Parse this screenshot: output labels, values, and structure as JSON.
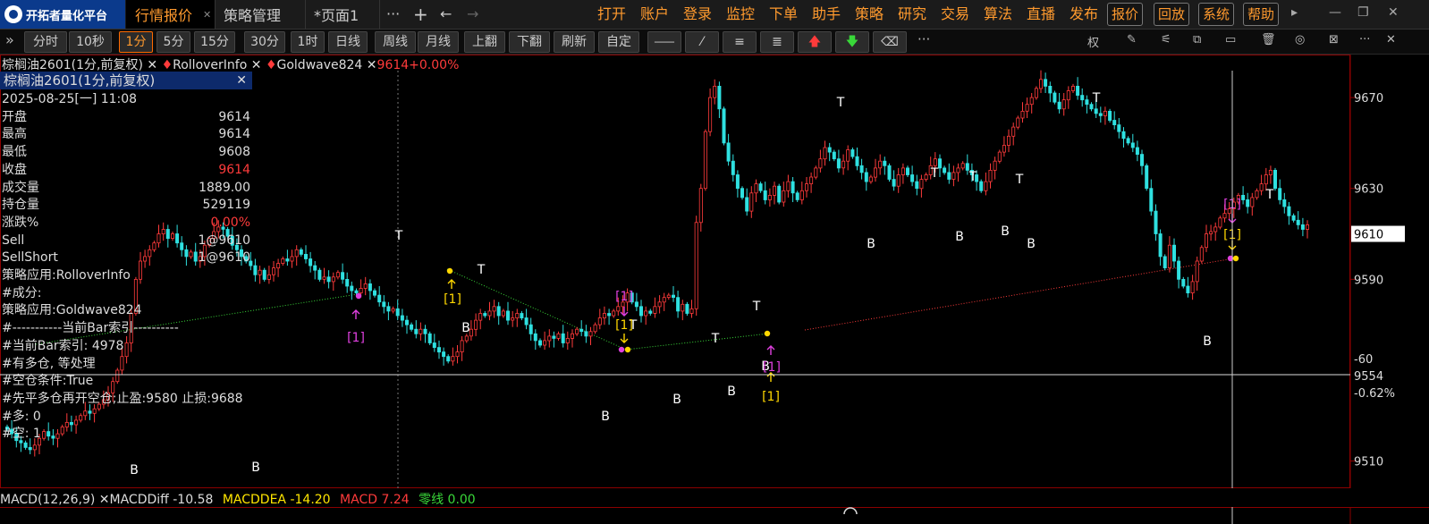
{
  "app": {
    "logo_text": "开拓者量化平台"
  },
  "tabs": [
    {
      "label": "行情报价",
      "active": true,
      "closable": true
    },
    {
      "label": "策略管理",
      "active": false,
      "closable": false
    },
    {
      "label": "*页面1",
      "active": false,
      "closable": false
    }
  ],
  "tab_actions": {
    "more": "···",
    "add": "+",
    "back": "←",
    "forward": "→"
  },
  "menu": [
    "打开",
    "账户",
    "登录",
    "监控",
    "下单",
    "助手",
    "策略",
    "研究",
    "交易",
    "算法",
    "直播",
    "发布"
  ],
  "menu_buttons": [
    "报价",
    "回放",
    "系统",
    "帮助"
  ],
  "window_controls": {
    "arrow": "▸",
    "min": "—",
    "max": "❐",
    "close": "✕"
  },
  "toolbar": {
    "expand": "»",
    "periods": [
      "分时",
      "10秒",
      "1分",
      "5分",
      "15分",
      "30分",
      "1时",
      "日线",
      "周线",
      "月线",
      "上翻",
      "下翻",
      "刷新",
      "自定"
    ],
    "selected_period": "1分",
    "more": "···",
    "right_label": "权"
  },
  "chart_header": {
    "symbol": "棕榈油2601(1分,前复权)",
    "ind1": "RolloverInfo",
    "ind2": "Goldwave824",
    "price_change": "9614+0.00%"
  },
  "info_panel": {
    "title": "棕榈油2601(1分,前复权)",
    "datetime": "2025-08-25[一] 11:08",
    "rows": [
      {
        "k": "开盘",
        "v": "9614"
      },
      {
        "k": "最高",
        "v": "9614"
      },
      {
        "k": "最低",
        "v": "9608"
      },
      {
        "k": "收盘",
        "v": "9614",
        "red": true
      },
      {
        "k": "成交量",
        "v": "1889.00"
      },
      {
        "k": "持仓量",
        "v": "529119"
      },
      {
        "k": "涨跌%",
        "v": "0.00%",
        "red": true
      },
      {
        "k": "Sell",
        "v": "1@9610"
      },
      {
        "k": "SellShort",
        "v": "1@9610"
      }
    ],
    "log": [
      "策略应用:RolloverInfo",
      "#成分:",
      "策略应用:Goldwave824",
      "#-----------当前Bar索引----------",
      "#当前Bar索引: 4978",
      "#有多仓, 等处理",
      "#空仓条件:True",
      "#先平多仓再开空仓;止盈:9580 止损:9688",
      "#多: 0",
      "#空: 1"
    ]
  },
  "y_axis": {
    "ticks": [
      "9670",
      "9630",
      "9590",
      "9510"
    ],
    "current": "9610",
    "cursor_value": "9554",
    "cursor_diff": "-60",
    "cursor_pct": "-0.62%"
  },
  "markers": {
    "top": "T",
    "bottom": "B",
    "signal": "[1]"
  },
  "macd_bar": {
    "name": "MACD(12,26,9)",
    "diff": "MACDDiff -10.58",
    "dea": "MACDDEA -14.20",
    "macd": "MACD 7.24",
    "zero": "零线 0.00"
  },
  "colors": {
    "up": "#ff3b3b",
    "down": "#2fe0e0",
    "accent": "#ff9a2e",
    "dea": "#ffe600",
    "zero": "#39d839",
    "signal_magenta": "#e040e0",
    "signal_yellow": "#ffd700"
  },
  "chart_data": {
    "type": "candlestick",
    "x_label": "",
    "y_label": "",
    "ylim": [
      9500,
      9685
    ],
    "y_ticks": [
      9510,
      9590,
      9630,
      9670
    ],
    "close": [
      9524,
      9522,
      9519,
      9518,
      9516,
      9515,
      9517,
      9520,
      9523,
      9521,
      9520,
      9522,
      9525,
      9527,
      9526,
      9528,
      9530,
      9532,
      9531,
      9533,
      9535,
      9537,
      9540,
      9545,
      9550,
      9556,
      9562,
      9575,
      9590,
      9598,
      9600,
      9603,
      9606,
      9610,
      9612,
      9608,
      9610,
      9606,
      9603,
      9600,
      9602,
      9598,
      9600,
      9605,
      9608,
      9611,
      9613,
      9612,
      9609,
      9605,
      9603,
      9600,
      9598,
      9596,
      9592,
      9594,
      9590,
      9592,
      9595,
      9597,
      9599,
      9598,
      9600,
      9603,
      9601,
      9599,
      9596,
      9594,
      9590,
      9591,
      9589,
      9591,
      9593,
      9590,
      9587,
      9585,
      9584,
      9586,
      9588,
      9585,
      9583,
      9580,
      9578,
      9576,
      9577,
      9574,
      9572,
      9570,
      9568,
      9566,
      9568,
      9566,
      9562,
      9560,
      9558,
      9556,
      9554,
      9556,
      9558,
      9563,
      9565,
      9568,
      9572,
      9575,
      9574,
      9576,
      9578,
      9574,
      9576,
      9572,
      9573,
      9575,
      9573,
      9570,
      9566,
      9563,
      9561,
      9563,
      9565,
      9564,
      9566,
      9562,
      9564,
      9566,
      9568,
      9567,
      9565,
      9567,
      9570,
      9573,
      9575,
      9574,
      9576,
      9578,
      9580,
      9584,
      9580,
      9578,
      9574,
      9576,
      9575,
      9578,
      9580,
      9582,
      9583,
      9582,
      9576,
      9579,
      9575,
      9577,
      9615,
      9630,
      9655,
      9670,
      9675,
      9665,
      9650,
      9642,
      9636,
      9630,
      9626,
      9620,
      9628,
      9632,
      9629,
      9625,
      9627,
      9631,
      9624,
      9629,
      9633,
      9628,
      9625,
      9629,
      9632,
      9635,
      9639,
      9643,
      9648,
      9646,
      9643,
      9639,
      9642,
      9647,
      9644,
      9640,
      9637,
      9633,
      9635,
      9639,
      9642,
      9640,
      9634,
      9631,
      9636,
      9639,
      9636,
      9633,
      9630,
      9634,
      9636,
      9640,
      9643,
      9639,
      9637,
      9634,
      9637,
      9639,
      9641,
      9638,
      9636,
      9633,
      9629,
      9633,
      9638,
      9642,
      9646,
      9649,
      9653,
      9657,
      9661,
      9664,
      9667,
      9670,
      9674,
      9678,
      9675,
      9672,
      9668,
      9665,
      9669,
      9673,
      9675,
      9671,
      9669,
      9667,
      9665,
      9663,
      9662,
      9664,
      9660,
      9658,
      9655,
      9652,
      9650,
      9648,
      9645,
      9640,
      9630,
      9620,
      9610,
      9600,
      9595,
      9605,
      9598,
      9590,
      9587,
      9584,
      9589,
      9598,
      9604,
      9610,
      9611,
      9613,
      9617,
      9619,
      9621,
      9624,
      9627,
      9625,
      9622,
      9626,
      9629,
      9632,
      9636,
      9638,
      9630,
      9625,
      9622,
      9618,
      9616,
      9614,
      9612,
      9614
    ]
  }
}
